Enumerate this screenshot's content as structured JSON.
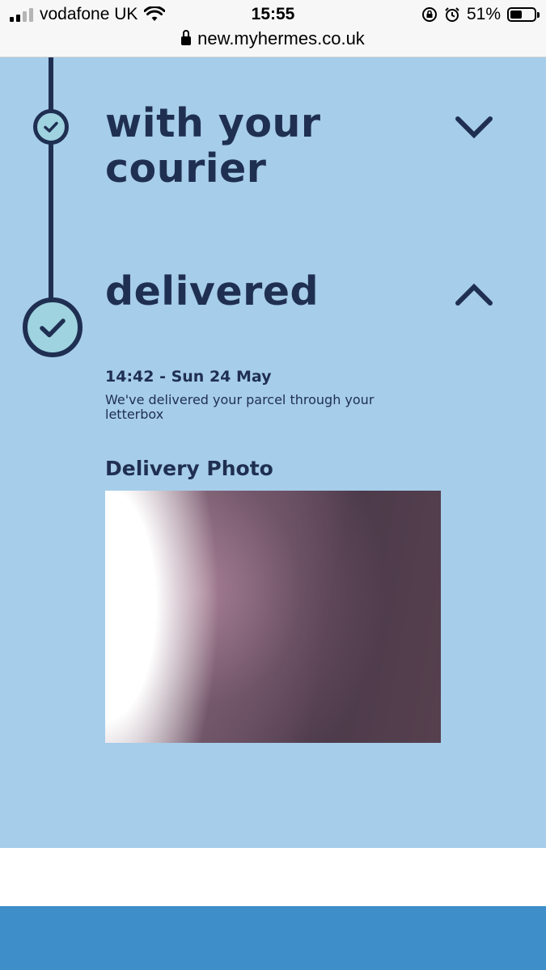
{
  "status_bar": {
    "carrier": "vodafone UK",
    "time": "15:55",
    "battery_percent": "51%",
    "battery_level": 0.51,
    "icons": [
      "signal-icon",
      "wifi-icon",
      "orientation-lock-icon",
      "alarm-icon",
      "battery-icon"
    ]
  },
  "url_bar": {
    "url": "new.myhermes.co.uk"
  },
  "tracking": {
    "steps": [
      {
        "title": "with your courier",
        "expanded": false,
        "chevron": "chevron-down-icon"
      },
      {
        "title": "delivered",
        "expanded": true,
        "chevron": "chevron-up-icon"
      }
    ],
    "event": {
      "time": "14:42 - Sun 24 May",
      "description": "We've delivered your parcel through your letterbox"
    },
    "photo_heading": "Delivery Photo"
  },
  "colors": {
    "panel_background": "#a6cdea",
    "text_navy": "#1f2f52",
    "check_fill": "#9fd3df",
    "footer_blue": "#3d8ec9"
  }
}
